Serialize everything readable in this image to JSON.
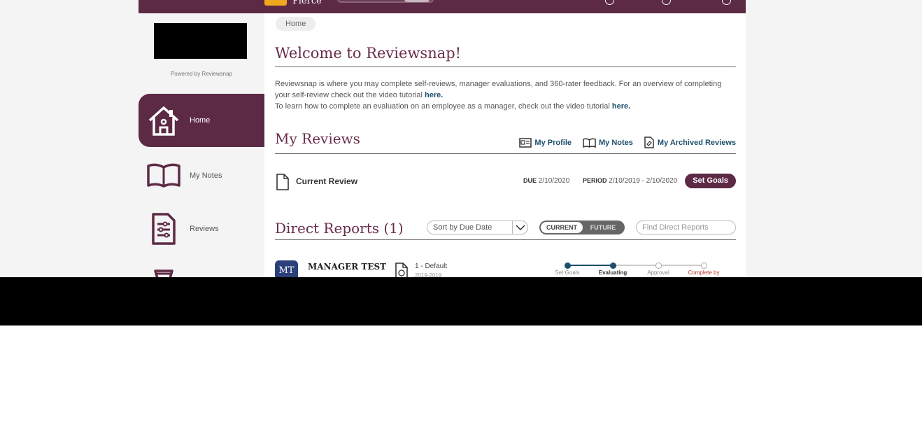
{
  "topbar": {
    "brand": "Pierce"
  },
  "sidebar": {
    "powered_by": "Powered by Reviewsnap",
    "items": [
      {
        "label": "Home",
        "icon": "home-icon",
        "active": true
      },
      {
        "label": "My Notes",
        "icon": "book-icon",
        "active": false
      },
      {
        "label": "Reviews",
        "icon": "review-doc-icon",
        "active": false
      },
      {
        "label": "",
        "icon": "trophy-icon",
        "active": false
      }
    ]
  },
  "breadcrumb": {
    "home": "Home"
  },
  "welcome": {
    "title": "Welcome to Reviewsnap!",
    "line1": "Reviewsnap is where you may complete self-reviews, manager evaluations, and 360-rater feedback. For an overview of completing your self-review check out the video tutorial ",
    "link1": "here.",
    "line2": "To learn how to complete an evaluation on an employee as a manager, check out the video tutorial ",
    "link2": "here."
  },
  "my_reviews": {
    "title": "My Reviews",
    "links": {
      "profile": "My Profile",
      "notes": "My Notes",
      "archived": "My Archived Reviews"
    },
    "current": {
      "name": "Current Review",
      "due_label": "DUE",
      "due": "2/10/2020",
      "period_label": "PERIOD",
      "period": "2/10/2019 - 2/10/2020",
      "action": "Set Goals"
    }
  },
  "direct_reports": {
    "title": "Direct Reports (1)",
    "sort_value": "Sort by Due Date",
    "toggle": {
      "current": "CURRENT",
      "future": "FUTURE"
    },
    "find_placeholder": "Find Direct Reports",
    "rows": [
      {
        "initials": "MT",
        "name": "MANAGER TEST",
        "review": "1 - Default",
        "review_sub": "2019-2019",
        "steps": [
          "Set Goals",
          "Evaluating",
          "Approval",
          "Complete by"
        ],
        "completed_steps": 2
      }
    ]
  },
  "colors": {
    "brand": "#5c2a44",
    "title": "#6a2d49",
    "link": "#1d4f6c",
    "accent": "#f0a81c"
  }
}
